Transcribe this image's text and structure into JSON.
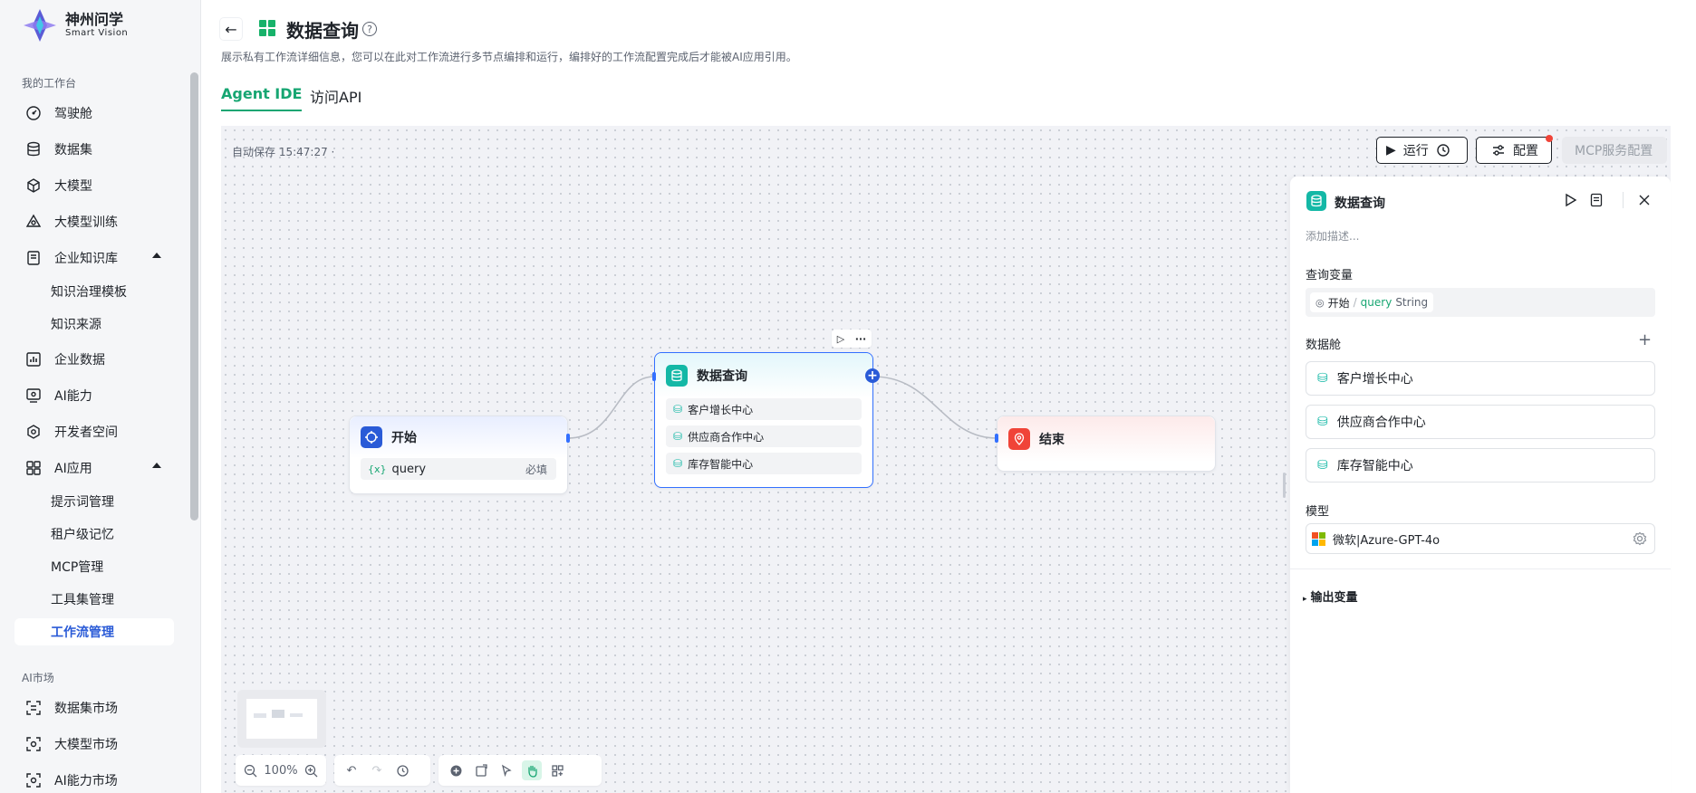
{
  "brand": {
    "name_cn": "神州问学",
    "name_en": "Smart Vision"
  },
  "sidebar": {
    "section_workspace": "我的工作台",
    "items": [
      {
        "label": "驾驶舱",
        "icon": "dashboard-icon"
      },
      {
        "label": "数据集",
        "icon": "database-icon"
      },
      {
        "label": "大模型",
        "icon": "cube-icon"
      },
      {
        "label": "大模型训练",
        "icon": "training-icon"
      },
      {
        "label": "企业知识库",
        "icon": "knowledge-icon"
      },
      {
        "label": "企业数据",
        "icon": "chart-icon"
      },
      {
        "label": "AI能力",
        "icon": "ai-ability-icon"
      },
      {
        "label": "开发者空间",
        "icon": "developer-icon"
      },
      {
        "label": "AI应用",
        "icon": "apps-icon"
      }
    ],
    "knowledge_sub": [
      "知识治理模板",
      "知识来源"
    ],
    "ai_app_sub": [
      "提示词管理",
      "租户级记忆",
      "MCP管理",
      "工具集管理",
      "工作流管理"
    ],
    "section_market": "AI市场",
    "market_items": [
      "数据集市场",
      "大模型市场",
      "AI能力市场"
    ]
  },
  "header": {
    "title": "数据查询",
    "description": "展示私有工作流详细信息，您可以在此对工作流进行多节点编排和运行，编排好的工作流配置完成后才能被AI应用引用。",
    "tabs": [
      "Agent IDE",
      "访问API"
    ]
  },
  "canvas": {
    "autosave": "自动保存 15:47:27 ·",
    "run_label": "运行",
    "config_label": "配置",
    "mcp_label": "MCP服务配置",
    "zoom": "100%"
  },
  "nodes": {
    "start": {
      "title": "开始",
      "var_badge": "{x}",
      "var_name": "query",
      "required": "必填"
    },
    "query": {
      "title": "数据查询",
      "rows": [
        "客户增长中心",
        "供应商合作中心",
        "库存智能中心"
      ]
    },
    "end": {
      "title": "结束"
    }
  },
  "panel": {
    "title": "数据查询",
    "desc_placeholder": "添加描述...",
    "query_var_label": "查询变量",
    "var_source": "开始",
    "var_sep": "/",
    "var_name": "query",
    "var_type": "String",
    "datasource_label": "数据舱",
    "datasources": [
      "客户增长中心",
      "供应商合作中心",
      "库存智能中心"
    ],
    "model_label": "模型",
    "model_value": "微软|Azure-GPT-4o",
    "output_label": "输出变量"
  },
  "colors": {
    "accent": "#17a672",
    "primary": "#2a5bd7",
    "teal": "#14b8a6",
    "danger": "#f04438"
  }
}
